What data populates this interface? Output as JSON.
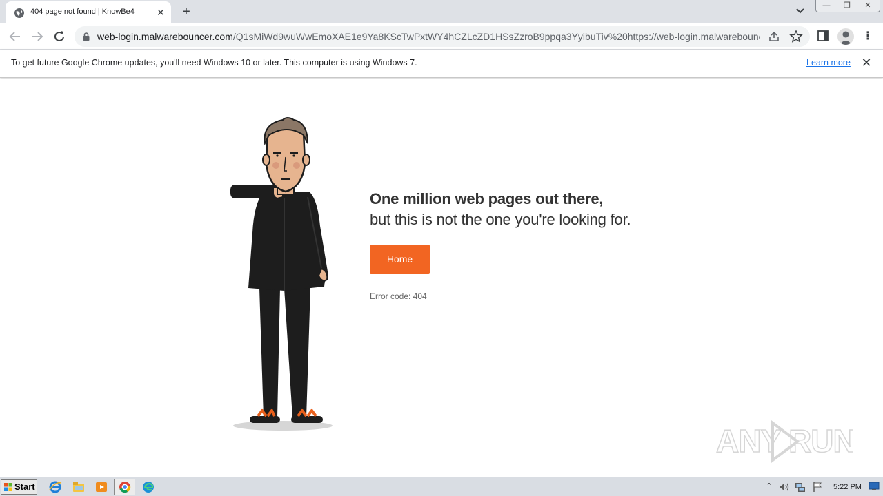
{
  "browser": {
    "tab": {
      "title": "404 page not found | KnowBe4",
      "close_glyph": "✕"
    },
    "new_tab_glyph": "+",
    "window_controls": {
      "minimize": "—",
      "restore": "❐",
      "close": "✕"
    },
    "address_bar": {
      "host": "web-login.malwarebouncer.com",
      "path": "/Q1sMiWd9wuWwEmoXAE1e9Ya8KScTwPxtWY4hCZLcZD1HSsZzroB9ppqa3YyibuTiv%20https://web-login.malwarebounc..."
    },
    "menu_glyph": "⋮"
  },
  "infobar": {
    "message": "To get future Google Chrome updates, you'll need Windows 10 or later. This computer is using Windows 7.",
    "link": "Learn more",
    "close_glyph": "✕"
  },
  "page": {
    "headline_line1": "One million web pages out there,",
    "headline_line2": "but this is not the one you're looking for.",
    "home_button": "Home",
    "error_code": "Error code: 404"
  },
  "watermark": {
    "text": "ANY RUN"
  },
  "taskbar": {
    "start_label": "Start",
    "tray_arrow": "⌃",
    "clock": "5:22 PM"
  },
  "colors": {
    "accent_orange": "#f26522",
    "tab_strip": "#dee1e6",
    "omnibox": "#f1f3f4",
    "taskbar": "#d9dde3",
    "link_blue": "#1a73e8"
  },
  "icons": [
    "globe-icon",
    "back-arrow-icon",
    "forward-arrow-icon",
    "reload-icon",
    "lock-icon",
    "share-icon",
    "star-icon",
    "side-panel-icon",
    "profile-icon",
    "windows-start-icon",
    "ie-icon",
    "explorer-icon",
    "media-player-icon",
    "chrome-icon",
    "edge-icon",
    "speaker-icon",
    "network-icon",
    "flag-icon"
  ]
}
